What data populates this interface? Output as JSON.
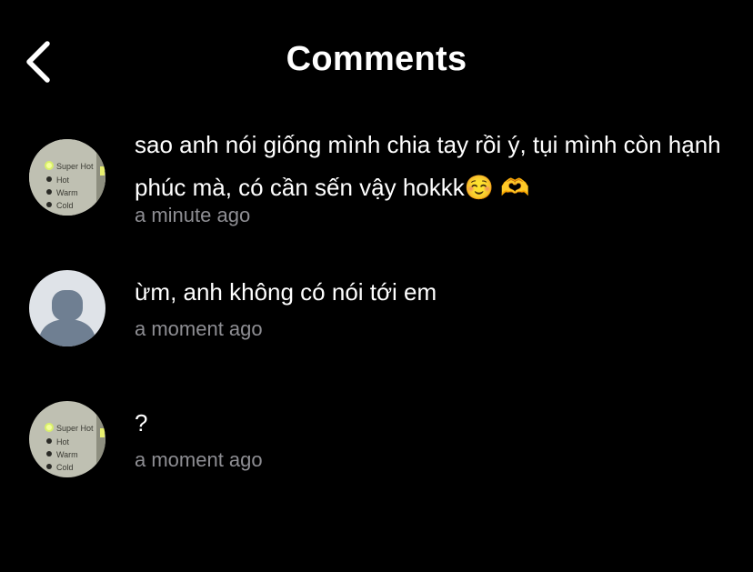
{
  "header": {
    "title": "Comments",
    "back_icon": "chevron-left-icon"
  },
  "comments": [
    {
      "avatar": "photo-avatar",
      "avatar_labels": [
        "Super Hot",
        "Hot",
        "Warm",
        "Cold"
      ],
      "text": "sao anh nói giống mình chia tay rồi ý, tụi mình còn hạnh phúc mà, có cần sến vậy hokkk☺️ 🫶",
      "time": "a minute ago"
    },
    {
      "avatar": "default-person-avatar",
      "text": "ừm, anh không có nói tới em",
      "time": "a moment ago"
    },
    {
      "avatar": "photo-avatar",
      "avatar_labels": [
        "Super Hot",
        "Hot",
        "Warm",
        "Cold"
      ],
      "text": "?",
      "time": "a moment ago"
    }
  ],
  "colors": {
    "background": "#000000",
    "text": "#ffffff",
    "timestamp": "#8e8e93"
  }
}
